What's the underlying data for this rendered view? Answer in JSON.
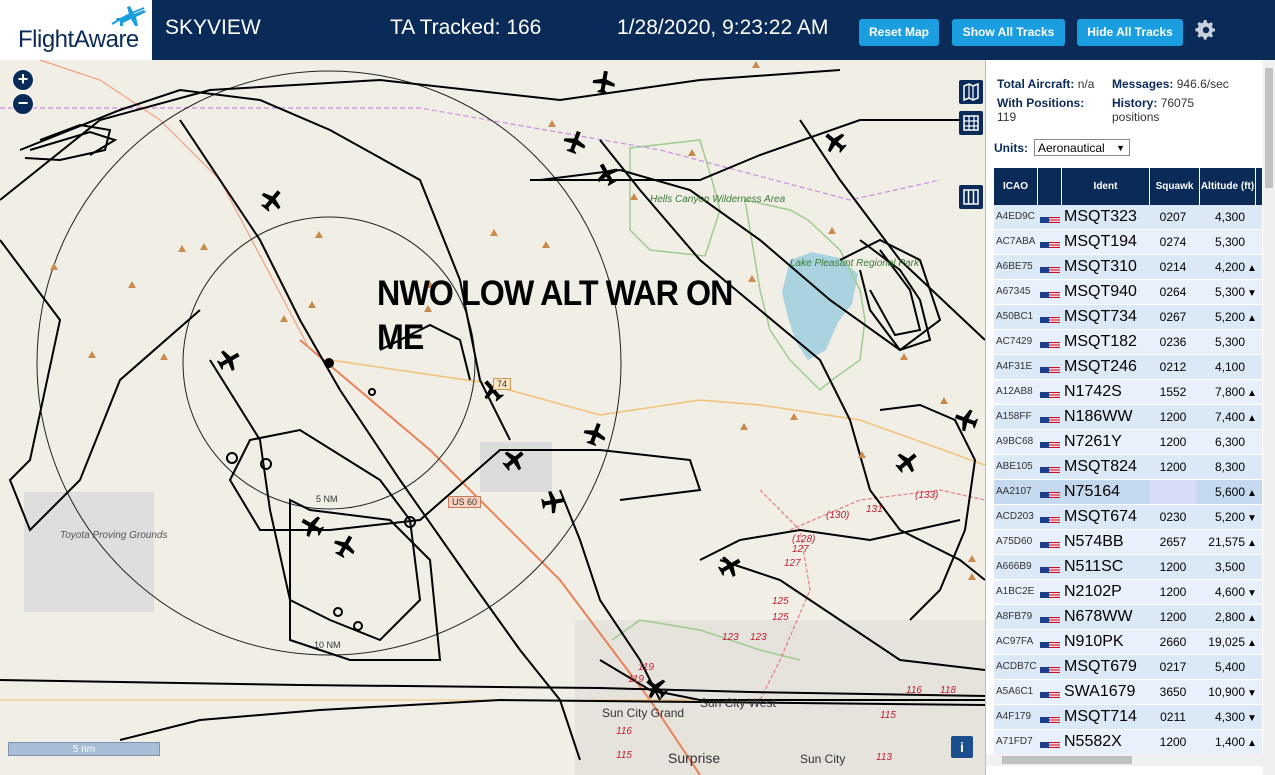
{
  "header": {
    "logo_text": "FlightAware",
    "site_name": "SKYVIEW",
    "ta_tracked": "TA Tracked: 166",
    "datetime": "1/28/2020, 9:23:22 AM",
    "buttons": {
      "reset_map": "Reset Map",
      "show_all": "Show All Tracks",
      "hide_all": "Hide All Tracks"
    },
    "icons": {
      "logo": "plane-logo-icon",
      "settings": "gear-icon"
    }
  },
  "map": {
    "overlay_text_line1": "NWO LOW ALT WAR ON",
    "overlay_text_line2": "ME",
    "zoom_in": "+",
    "zoom_out": "−",
    "scale_label": "5 nm",
    "info_label": "i",
    "controls": [
      "map-layers-icon",
      "grid-icon",
      "columns-icon"
    ],
    "labels": {
      "hells_canyon": "Hells Canyon Wilderness Area",
      "lake_pleasant": "Lake Pleasant Regional Park",
      "toyota": "Toyota Proving Grounds",
      "sun_city_grand": "Sun City Grand",
      "sun_city_west": "Sun City West",
      "sun_city": "Sun City",
      "surprise": "Surprise",
      "ring_5nm": "5 NM",
      "ring_10nm": "10 NM",
      "us60_a": "74",
      "us60_b": "US 60"
    },
    "road_numbers": [
      "131",
      "(130)",
      "(133)",
      "(128)",
      "127",
      "127",
      "125",
      "125",
      "123",
      "123",
      "119",
      "119",
      "116",
      "115",
      "116",
      "118",
      "113",
      "115"
    ]
  },
  "panel": {
    "total_aircraft_label": "Total Aircraft:",
    "total_aircraft_value": "n/a",
    "messages_label": "Messages:",
    "messages_value": "946.6/sec",
    "with_positions_label": "With Positions:",
    "with_positions_value": "119",
    "history_label": "History:",
    "history_value": "76075 positions",
    "units_label": "Units:",
    "units_value": "Aeronautical",
    "columns": {
      "icao": "ICAO",
      "flag": "",
      "ident": "Ident",
      "squawk": "Squawk",
      "altitude": "Altitude (ft)"
    },
    "rows": [
      {
        "icao": "A4ED9C",
        "ident": "MSQT323",
        "squawk": "0207",
        "altitude": "4,300",
        "trend": ""
      },
      {
        "icao": "AC7ABA",
        "ident": "MSQT194",
        "squawk": "0274",
        "altitude": "5,300",
        "trend": ""
      },
      {
        "icao": "A6BE75",
        "ident": "MSQT310",
        "squawk": "0214",
        "altitude": "4,200",
        "trend": "▲"
      },
      {
        "icao": "A67345",
        "ident": "MSQT940",
        "squawk": "0264",
        "altitude": "5,300",
        "trend": "▼"
      },
      {
        "icao": "A50BC1",
        "ident": "MSQT734",
        "squawk": "0267",
        "altitude": "5,200",
        "trend": "▲"
      },
      {
        "icao": "AC7429",
        "ident": "MSQT182",
        "squawk": "0236",
        "altitude": "5,300",
        "trend": ""
      },
      {
        "icao": "A4F31E",
        "ident": "MSQT246",
        "squawk": "0212",
        "altitude": "4,100",
        "trend": ""
      },
      {
        "icao": "A12AB8",
        "ident": "N1742S",
        "squawk": "1552",
        "altitude": "7,800",
        "trend": "▲"
      },
      {
        "icao": "A158FF",
        "ident": "N186WW",
        "squawk": "1200",
        "altitude": "7,400",
        "trend": "▲"
      },
      {
        "icao": "A9BC68",
        "ident": "N7261Y",
        "squawk": "1200",
        "altitude": "6,300",
        "trend": ""
      },
      {
        "icao": "ABE105",
        "ident": "MSQT824",
        "squawk": "1200",
        "altitude": "8,300",
        "trend": ""
      },
      {
        "icao": "AA2107",
        "ident": "N75164",
        "squawk": "",
        "altitude": "5,600",
        "trend": "▲"
      },
      {
        "icao": "ACD203",
        "ident": "MSQT674",
        "squawk": "0230",
        "altitude": "5,200",
        "trend": "▼"
      },
      {
        "icao": "A75D60",
        "ident": "N574BB",
        "squawk": "2657",
        "altitude": "21,575",
        "trend": "▲"
      },
      {
        "icao": "A666B9",
        "ident": "N511SC",
        "squawk": "1200",
        "altitude": "3,500",
        "trend": ""
      },
      {
        "icao": "A1BC2E",
        "ident": "N2102P",
        "squawk": "1200",
        "altitude": "4,600",
        "trend": "▼"
      },
      {
        "icao": "A8FB79",
        "ident": "N678WW",
        "squawk": "1200",
        "altitude": "2,800",
        "trend": "▲"
      },
      {
        "icao": "AC97FA",
        "ident": "N910PK",
        "squawk": "2660",
        "altitude": "19,025",
        "trend": "▲"
      },
      {
        "icao": "ACDB7C",
        "ident": "MSQT679",
        "squawk": "0217",
        "altitude": "5,400",
        "trend": ""
      },
      {
        "icao": "A5A6C1",
        "ident": "SWA1679",
        "squawk": "3650",
        "altitude": "10,900",
        "trend": "▼"
      },
      {
        "icao": "A4F179",
        "ident": "MSQT714",
        "squawk": "0211",
        "altitude": "4,300",
        "trend": "▼"
      },
      {
        "icao": "A71FD7",
        "ident": "N5582X",
        "squawk": "1200",
        "altitude": "1,400",
        "trend": "▲"
      }
    ],
    "selected_row": 11
  },
  "colors": {
    "header_bg": "#0a2a58",
    "button": "#1b9ee0",
    "map_bg": "#f1eee6",
    "track": "#000000",
    "water": "#aad3df"
  }
}
